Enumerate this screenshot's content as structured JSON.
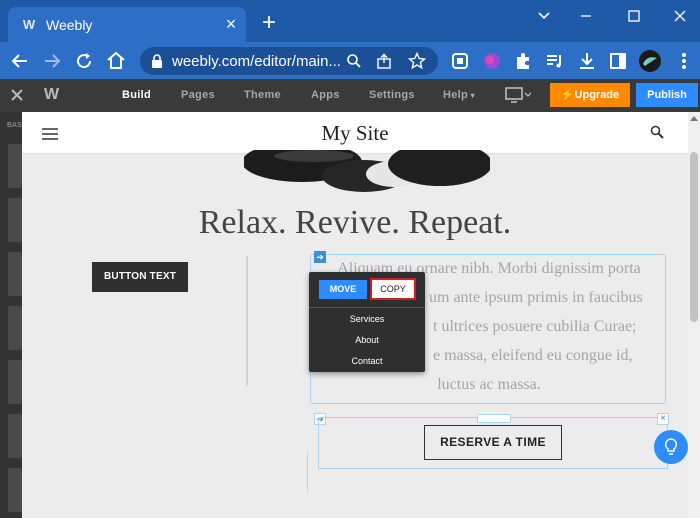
{
  "browser": {
    "tab_title": "Weebly",
    "url": "weebly.com/editor/main...",
    "accent": "#2d6fc6"
  },
  "editor": {
    "logo": "W",
    "nav": [
      "Build",
      "Pages",
      "Theme",
      "Apps",
      "Settings",
      "Help"
    ],
    "upgrade_label": "Upgrade",
    "publish_label": "Publish",
    "upgrade_color": "#ff8a00",
    "publish_color": "#2d8cff",
    "left_label": "BASI"
  },
  "site": {
    "title": "My Site",
    "headline": "Relax. Revive. Repeat.",
    "button_text": "BUTTON TEXT",
    "paragraph_lines": [
      "Aliquam eu ornare nibh. Morbi dignissim porta",
      "um ante ipsum primis in faucibus",
      "t ultrices posuere cubilia Curae;",
      "e massa, eleifend eu congue id,",
      "luctus ac massa."
    ],
    "reserve_label": "RESERVE A TIME"
  },
  "popup": {
    "move_label": "MOVE",
    "copy_label": "COPY",
    "items": [
      "Services",
      "About",
      "Contact"
    ]
  }
}
